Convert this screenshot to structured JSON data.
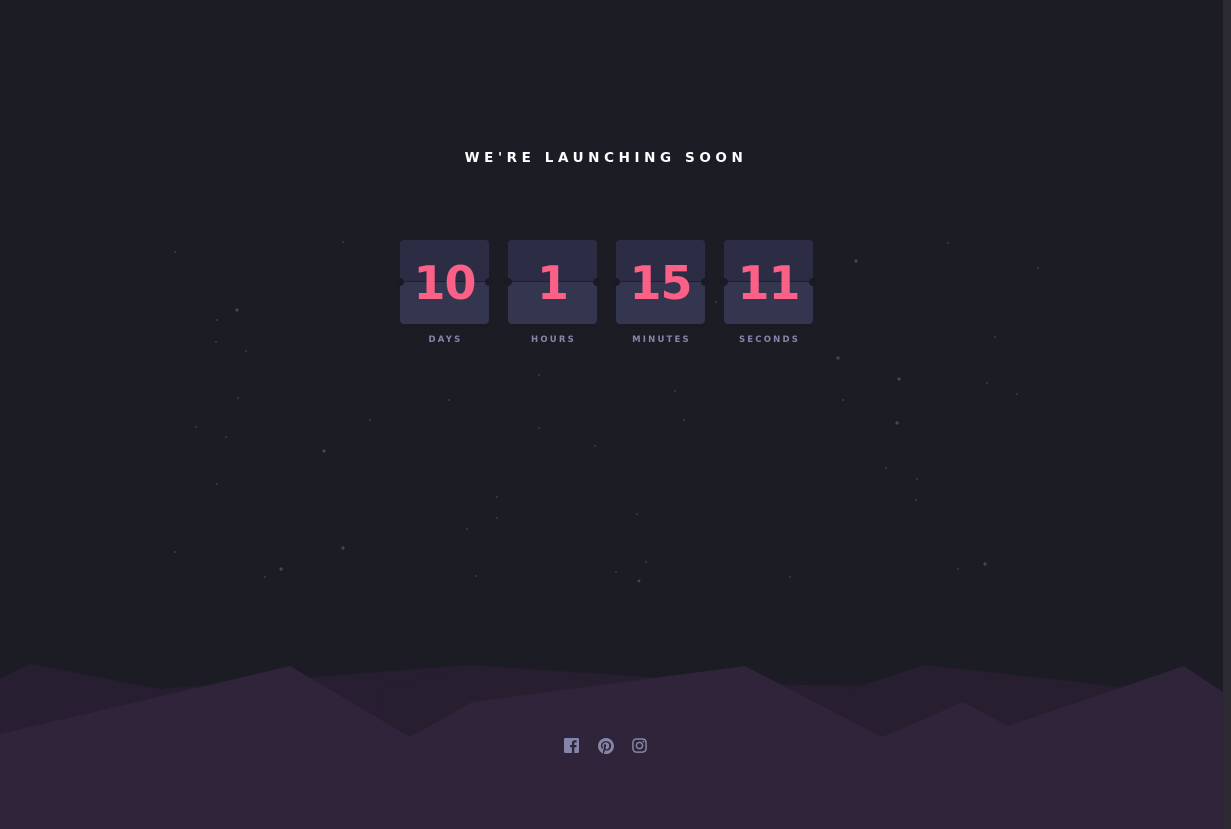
{
  "headline": "WE'RE LAUNCHING SOON",
  "countdown": [
    {
      "value": "10",
      "label": "DAYS"
    },
    {
      "value": "1",
      "label": "HOURS"
    },
    {
      "value": "15",
      "label": "MINUTES"
    },
    {
      "value": "11",
      "label": "SECONDS"
    }
  ],
  "social": [
    {
      "name": "facebook-icon"
    },
    {
      "name": "pinterest-icon"
    },
    {
      "name": "instagram-icon"
    }
  ],
  "colors": {
    "background": "#1c1c25",
    "card": "#343650",
    "card_top": "#2c2c44",
    "digits": "#fb6087",
    "label": "#8486a9",
    "headline": "#ffffff",
    "hills_front": "#2f2439",
    "hills_back": "#271f31",
    "icons": "#8486a9"
  }
}
